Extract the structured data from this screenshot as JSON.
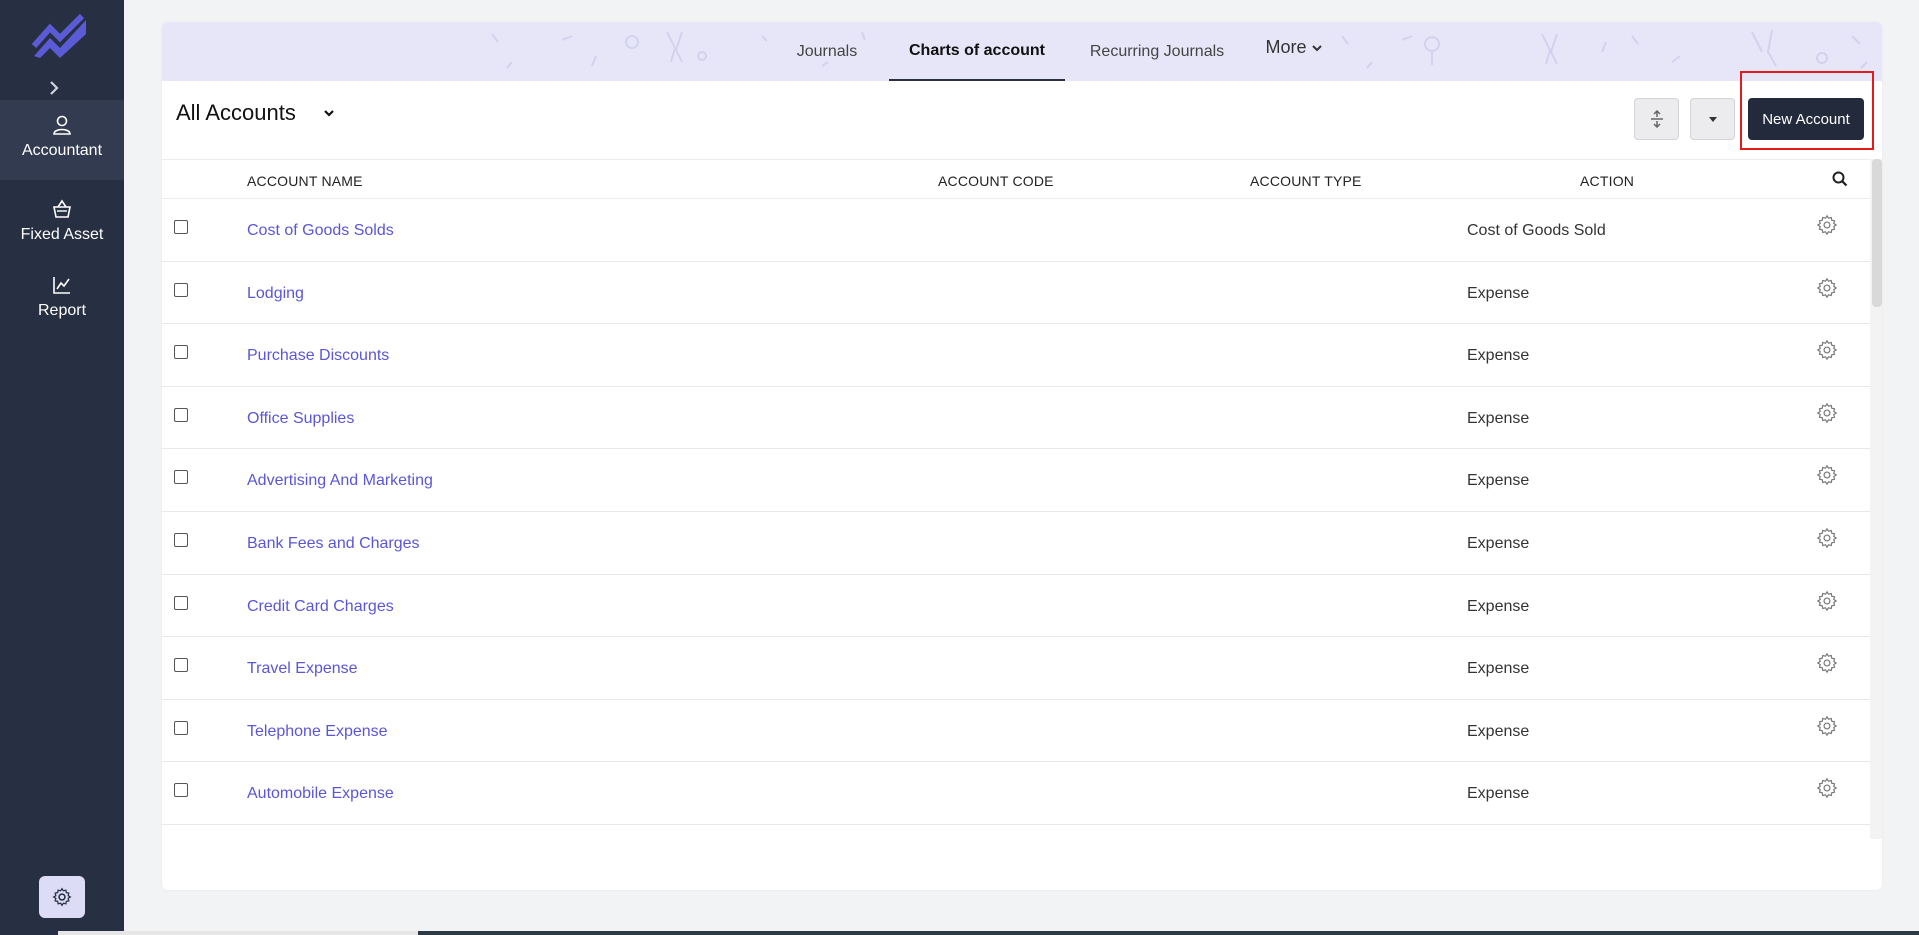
{
  "sidebar": {
    "items": [
      {
        "label": "Accountant",
        "icon": "user-icon",
        "active": true
      },
      {
        "label": "Fixed Asset",
        "icon": "basket-icon",
        "active": false
      },
      {
        "label": "Report",
        "icon": "chart-line-icon",
        "active": false
      }
    ],
    "settings_icon": "gear-icon",
    "accent": "#5b5bd6"
  },
  "tabs": {
    "journals": "Journals",
    "charts": "Charts of account",
    "recurring": "Recurring Journals",
    "more": "More"
  },
  "toolbar": {
    "view": "All Accounts",
    "new_account": "New Account"
  },
  "table": {
    "headers": {
      "name": "ACCOUNT NAME",
      "code": "ACCOUNT CODE",
      "type": "ACCOUNT TYPE",
      "action": "ACTION"
    },
    "rows": [
      {
        "name": "Cost of Goods Solds",
        "type": "Cost of Goods Sold"
      },
      {
        "name": "Lodging",
        "type": "Expense"
      },
      {
        "name": "Purchase Discounts",
        "type": "Expense"
      },
      {
        "name": "Office Supplies",
        "type": "Expense"
      },
      {
        "name": "Advertising And Marketing",
        "type": "Expense"
      },
      {
        "name": "Bank Fees and Charges",
        "type": "Expense"
      },
      {
        "name": "Credit Card Charges",
        "type": "Expense"
      },
      {
        "name": "Travel Expense",
        "type": "Expense"
      },
      {
        "name": "Telephone Expense",
        "type": "Expense"
      },
      {
        "name": "Automobile Expense",
        "type": "Expense"
      }
    ]
  },
  "colors": {
    "sidebar_bg": "#272f42",
    "link": "#5a56d6",
    "primary_button": "#222a3c",
    "tabbar_bg": "#e7e6f8",
    "highlight": "#e41b1b"
  }
}
